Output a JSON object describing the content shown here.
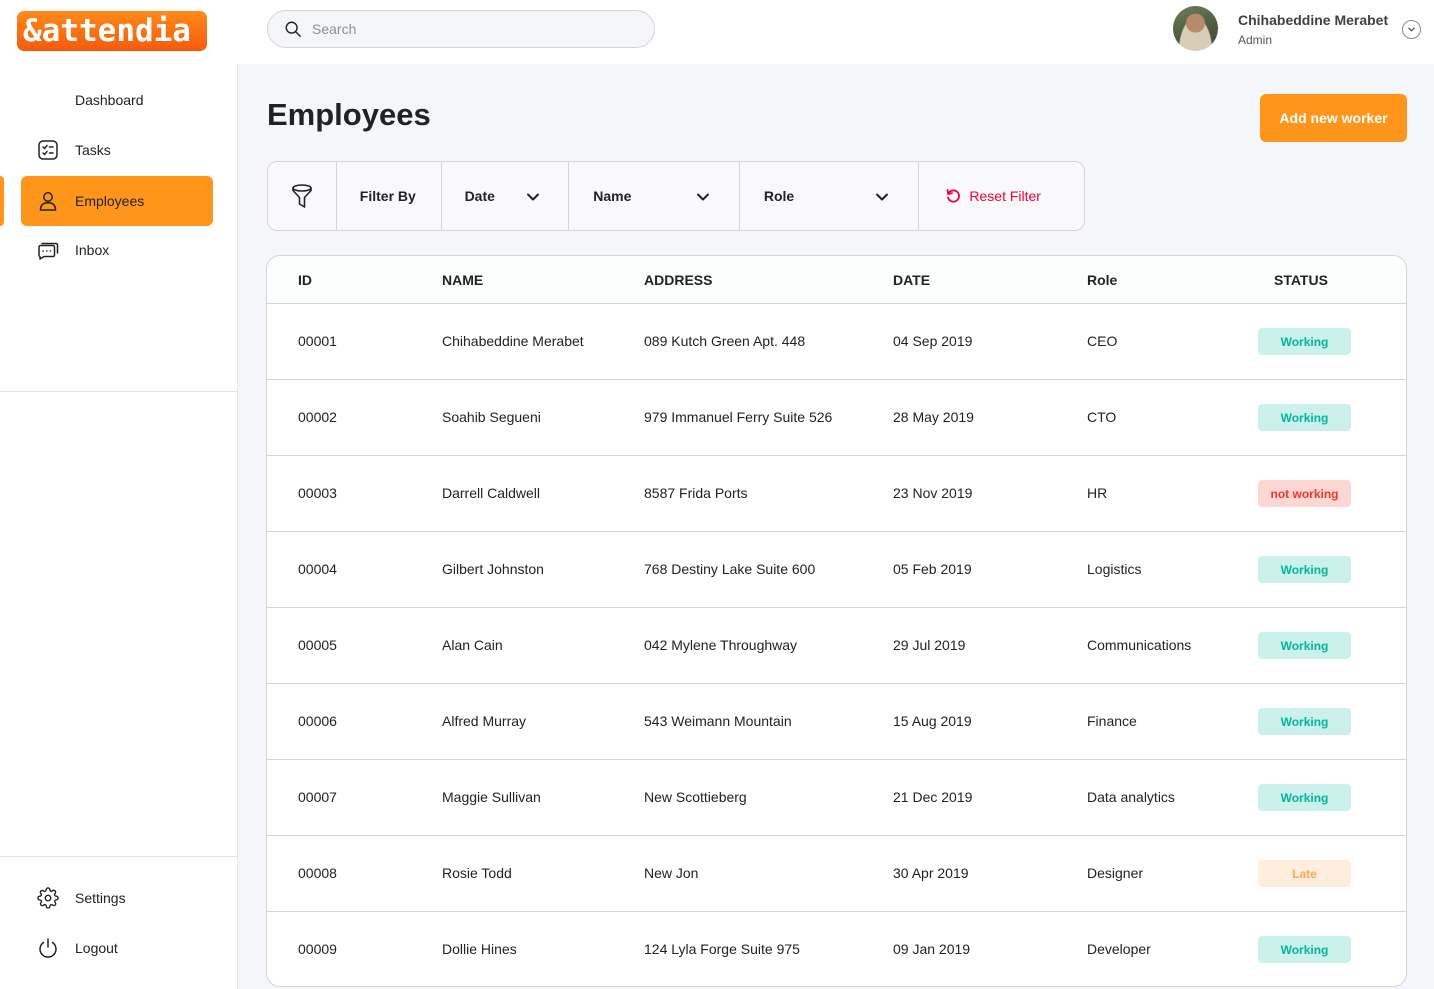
{
  "brand": {
    "logo_text": "&attendia"
  },
  "search": {
    "placeholder": "Search",
    "value": ""
  },
  "user": {
    "name": "Chihabeddine Merabet",
    "role": "Admin"
  },
  "sidebar": {
    "items": [
      {
        "label": "Dashboard",
        "icon": "dashboard-icon"
      },
      {
        "label": "Tasks",
        "icon": "checklist-icon"
      },
      {
        "label": "Employees",
        "icon": "user-icon",
        "active": true
      },
      {
        "label": "Inbox",
        "icon": "chat-icon"
      }
    ],
    "bottom": [
      {
        "label": "Settings",
        "icon": "gear-icon"
      },
      {
        "label": "Logout",
        "icon": "power-icon"
      }
    ]
  },
  "page": {
    "title": "Employees",
    "add_button": "Add new worker"
  },
  "filters": {
    "filter_label": "Filter By",
    "date": "Date",
    "name": "Name",
    "role": "Role",
    "reset": "Reset Filter"
  },
  "table": {
    "headers": [
      "ID",
      "NAME",
      "ADDRESS",
      "DATE",
      "Role",
      "STATUS"
    ],
    "rows": [
      {
        "id": "00001",
        "name": "Chihabeddine Merabet",
        "address": "089 Kutch Green Apt. 448",
        "date": "04 Sep 2019",
        "role": "CEO",
        "status": "Working",
        "status_type": "working"
      },
      {
        "id": "00002",
        "name": "Soahib Segueni",
        "address": "979 Immanuel Ferry Suite 526",
        "date": "28 May 2019",
        "role": "CTO",
        "status": "Working",
        "status_type": "working"
      },
      {
        "id": "00003",
        "name": "Darrell Caldwell",
        "address": "8587 Frida Ports",
        "date": "23 Nov 2019",
        "role": "HR",
        "status": "not working",
        "status_type": "notworking"
      },
      {
        "id": "00004",
        "name": "Gilbert Johnston",
        "address": "768 Destiny Lake Suite 600",
        "date": "05 Feb 2019",
        "role": "Logistics",
        "status": "Working",
        "status_type": "working"
      },
      {
        "id": "00005",
        "name": "Alan Cain",
        "address": "042 Mylene Throughway",
        "date": "29 Jul 2019",
        "role": "Communications",
        "status": "Working",
        "status_type": "working"
      },
      {
        "id": "00006",
        "name": "Alfred Murray",
        "address": "543 Weimann Mountain",
        "date": "15 Aug 2019",
        "role": "Finance",
        "status": "Working",
        "status_type": "working"
      },
      {
        "id": "00007",
        "name": "Maggie Sullivan",
        "address": "New Scottieberg",
        "date": "21 Dec 2019",
        "role": "Data analytics",
        "status": "Working",
        "status_type": "working"
      },
      {
        "id": "00008",
        "name": "Rosie Todd",
        "address": "New Jon",
        "date": "30 Apr 2019",
        "role": "Designer",
        "status": "Late",
        "status_type": "late"
      },
      {
        "id": "00009",
        "name": "Dollie Hines",
        "address": "124 Lyla Forge Suite 975",
        "date": "09 Jan 2019",
        "role": "Developer",
        "status": "Working",
        "status_type": "working"
      }
    ]
  },
  "colors": {
    "accent": "#ff961b",
    "working_bg": "#ccf0eb",
    "working_text": "#00b69b",
    "notworking_bg": "#fcd7d4",
    "notworking_text": "#ef3826",
    "late_bg": "#ffeddd",
    "late_text": "#ffa756",
    "reset_text": "#ea0234"
  }
}
